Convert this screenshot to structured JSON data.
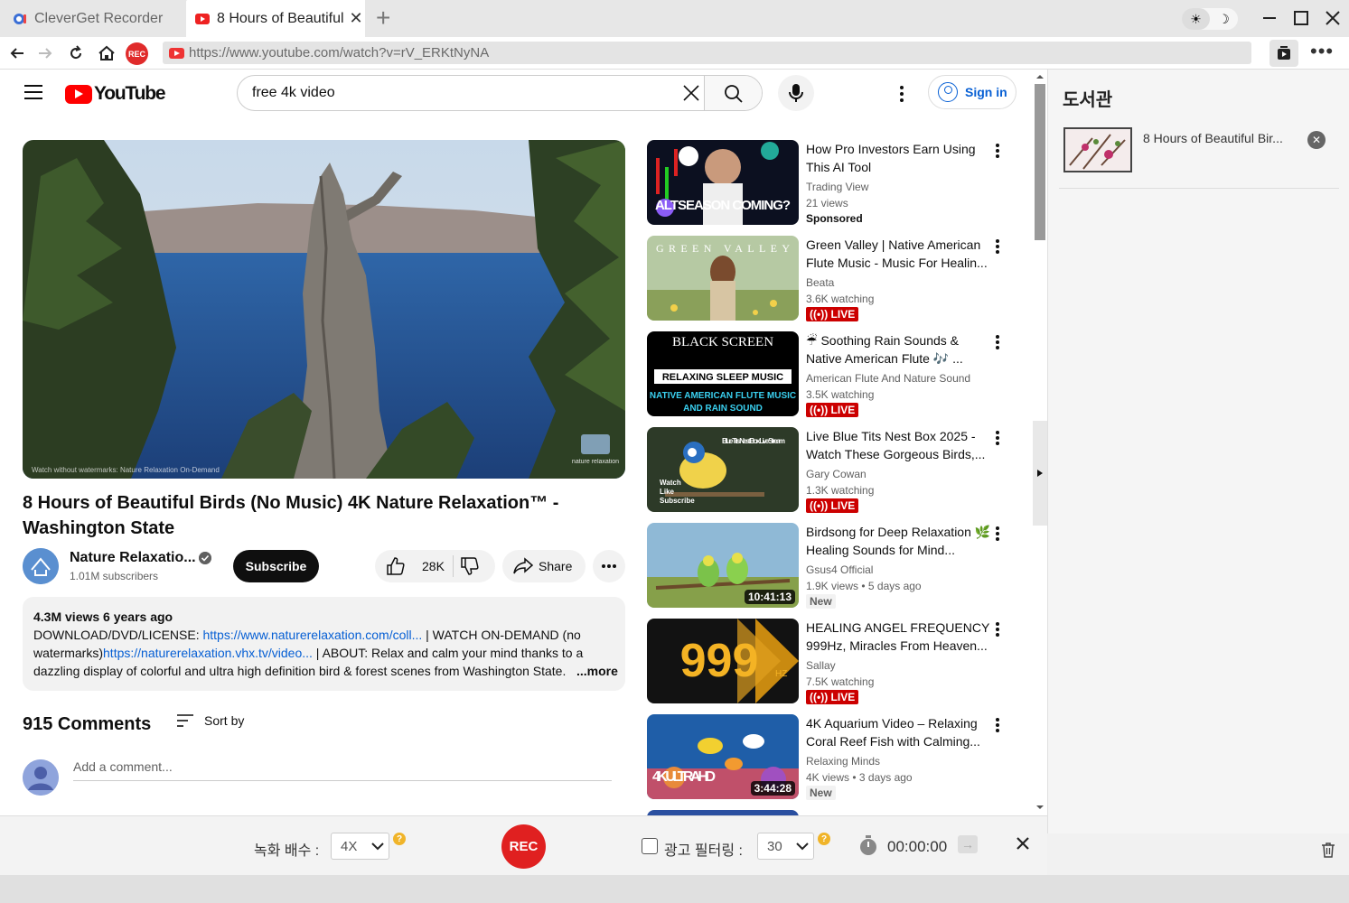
{
  "tabs": [
    {
      "label": "CleverGet Recorder",
      "active": false
    },
    {
      "label": "8 Hours of Beautiful",
      "active": true
    }
  ],
  "address": {
    "url": "https://www.youtube.com/watch?v=rV_ERKtNyNA",
    "rec_label": "REC"
  },
  "youtube": {
    "logo_text": "YouTube",
    "search_query": "free 4k video",
    "signin_label": "Sign in"
  },
  "video": {
    "title": "8 Hours of Beautiful Birds (No Music) 4K Nature Relaxation™ - Washington State",
    "channel": "Nature Relaxatio...",
    "subscribers": "1.01M subscribers",
    "subscribe_label": "Subscribe",
    "likes": "28K",
    "share_label": "Share",
    "watermark_left": "Watch without watermarks: Nature Relaxation On-Demand",
    "watermark_logo": "nature relaxation"
  },
  "description": {
    "meta": "4.3M views  6 years ago",
    "line1_prefix": "DOWNLOAD/DVD/LICENSE: ",
    "line1_link": "https://www.naturerelaxation.com/coll...",
    "line1_suffix": " | WATCH ON-DEMAND (no",
    "line2_prefix": "watermarks)",
    "line2_link": "https://naturerelaxation.vhx.tv/video...",
    "line2_suffix": " | ABOUT: Relax and calm your mind thanks to a",
    "line3": "dazzling display of colorful and ultra high definition bird & forest scenes from Washington State.",
    "more_label": "...more"
  },
  "comments": {
    "count_label": "915 Comments",
    "sort_label": "Sort by",
    "placeholder": "Add a comment..."
  },
  "recommendations": [
    {
      "title": "How Pro Investors Earn Using This AI Tool",
      "channel": "Trading View",
      "views": "21 views",
      "badge": "Sponsored",
      "badge_type": "sponsored",
      "thumb_text": "ALTSEASON COMING?",
      "duration": ""
    },
    {
      "title": "Green Valley | Native American Flute Music - Music For Healin...",
      "channel": "Beata",
      "views": "3.6K watching",
      "badge": "LIVE",
      "badge_type": "live",
      "thumb_text": "GREEN VALLEY",
      "duration": ""
    },
    {
      "title": "☔ Soothing Rain Sounds & Native American Flute 🎶 ...",
      "channel": "American Flute And Nature Sound",
      "views": "3.5K watching",
      "badge": "LIVE",
      "badge_type": "live",
      "thumb_text": "BLACK SCREEN",
      "duration": ""
    },
    {
      "title": "Live Blue Tits Nest Box 2025 - Watch These Gorgeous Birds,...",
      "channel": "Gary Cowan",
      "views": "1.3K watching",
      "badge": "LIVE",
      "badge_type": "live",
      "thumb_text": "Blue Tits Nest Box Live Stream",
      "duration": ""
    },
    {
      "title": "Birdsong for Deep Relaxation 🌿 Healing Sounds for Mind...",
      "channel": "Gsus4 Official",
      "views": "1.9K views  • 5 days ago",
      "badge": "New",
      "badge_type": "new",
      "thumb_text": "",
      "duration": "10:41:13"
    },
    {
      "title": "HEALING ANGEL FREQUENCY 999Hz, Miracles From Heaven...",
      "channel": "Sallay",
      "views": "7.5K watching",
      "badge": "LIVE",
      "badge_type": "live",
      "thumb_text": "999",
      "duration": ""
    },
    {
      "title": "4K Aquarium Video – Relaxing Coral Reef Fish with Calming...",
      "channel": "Relaxing Minds",
      "views": "4K views  • 3 days ago",
      "badge": "New",
      "badge_type": "new",
      "thumb_text": "4K ULTRA HD",
      "duration": "3:44:28"
    }
  ],
  "library": {
    "title": "도서관",
    "items": [
      {
        "name": "8 Hours of Beautiful Bir..."
      }
    ]
  },
  "recorder": {
    "speed_label": "녹화 배수 :",
    "speed_value": "4X",
    "rec_label": "REC",
    "ad_filter_label": "광고 필터링 :",
    "ad_filter_value": "30",
    "timer": "00:00:00",
    "help": "?"
  },
  "colors": {
    "rec_red": "#e02020",
    "yt_red": "#ff0000",
    "link_blue": "#065fd4",
    "live_red": "#cc0000"
  }
}
